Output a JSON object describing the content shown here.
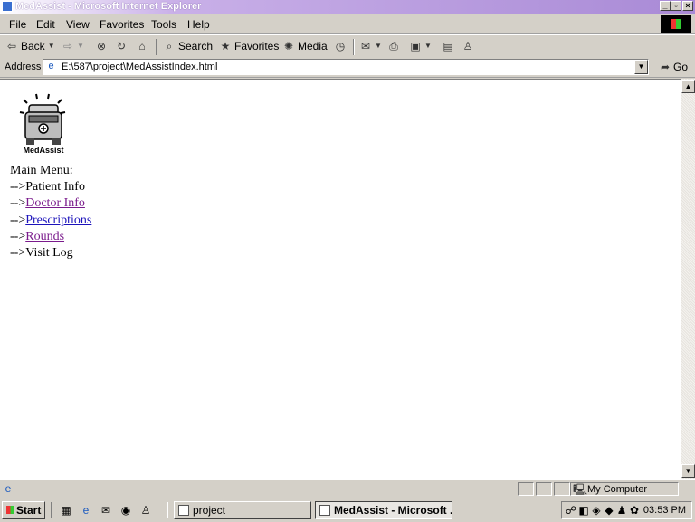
{
  "window": {
    "title": "MedAssist - Microsoft Internet Explorer"
  },
  "menubar": {
    "items": [
      "File",
      "Edit",
      "View",
      "Favorites",
      "Tools",
      "Help"
    ]
  },
  "toolbar": {
    "back": "Back",
    "search": "Search",
    "favorites": "Favorites",
    "media": "Media"
  },
  "address": {
    "label": "Address",
    "url": "E:\\587\\project\\MedAssistIndex.html",
    "go": "Go"
  },
  "page": {
    "logo_text": "MedAssist",
    "menu_title": "Main Menu:",
    "items": [
      {
        "prefix": "-->",
        "label": "Patient Info"
      },
      {
        "prefix": "-->",
        "label": "Doctor Info"
      },
      {
        "prefix": "-->",
        "label": "Prescriptions"
      },
      {
        "prefix": "-->",
        "label": "Rounds"
      },
      {
        "prefix": "-->",
        "label": "Visit Log"
      }
    ]
  },
  "status": {
    "zone": "My Computer"
  },
  "taskbar": {
    "start": "Start",
    "tasks": [
      "project",
      "MedAssist - Microsoft ..."
    ],
    "clock": "03:53 PM"
  }
}
